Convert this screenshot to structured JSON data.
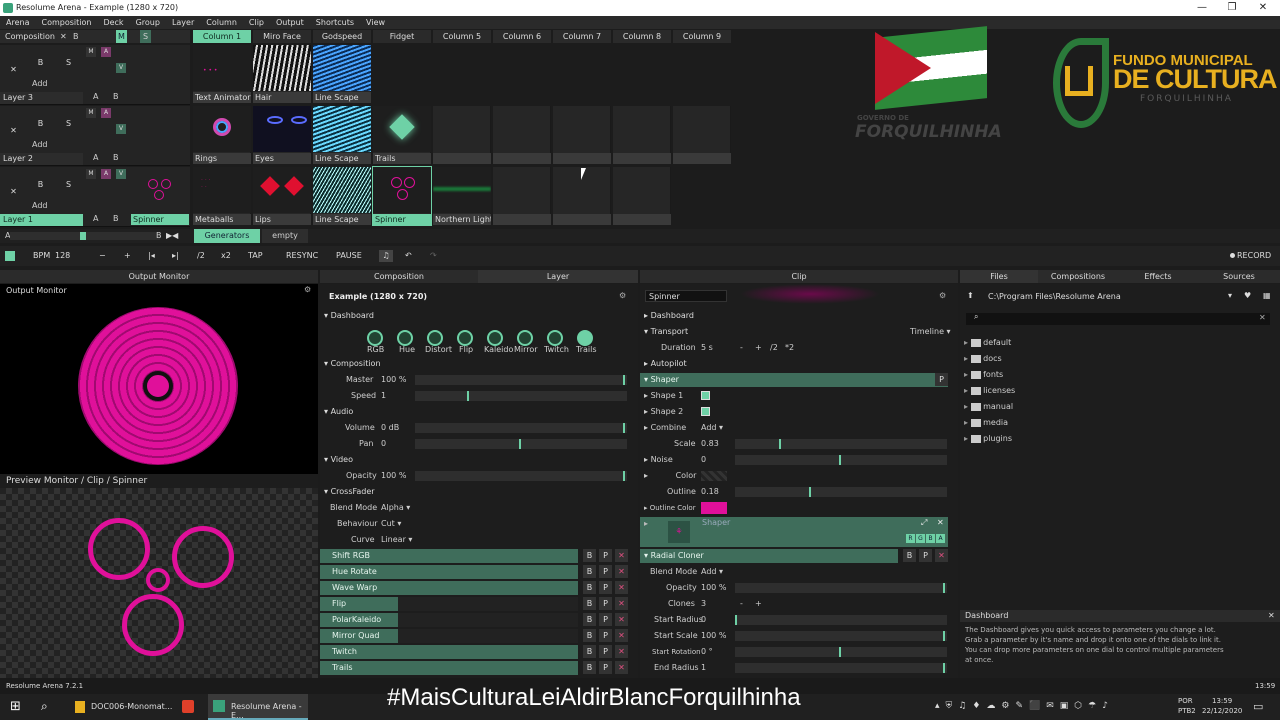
{
  "window": {
    "title": "Resolume Arena - Example (1280 x 720)",
    "minimize": "—",
    "maximize": "❐",
    "close": "✕"
  },
  "menu": [
    "Arena",
    "Composition",
    "Deck",
    "Group",
    "Layer",
    "Column",
    "Clip",
    "Output",
    "Shortcuts",
    "View"
  ],
  "composition": {
    "label": "Composition",
    "x": "✕",
    "b": "B",
    "m": "M",
    "s": "S"
  },
  "columns": [
    "Column 1",
    "Miro Face",
    "Godspeed",
    "Fidget",
    "Column 5",
    "Column 6",
    "Column 7",
    "Column 8",
    "Column 9"
  ],
  "layers": [
    {
      "name": "Layer 3",
      "clips": [
        "Text Animator",
        "Hair",
        "Line Scape",
        "",
        "",
        "",
        "",
        "",
        ""
      ]
    },
    {
      "name": "Layer 2",
      "clips": [
        "Rings",
        "Eyes",
        "Line Scape",
        "Trails",
        "",
        "",
        "",
        "",
        ""
      ]
    },
    {
      "name": "Layer 1",
      "clips": [
        "Spinner",
        "Metaballs",
        "Lips",
        "Line Scape",
        "Spinner",
        "Northern Light",
        "",
        "",
        ""
      ]
    }
  ],
  "layer_buttons": {
    "close": "✕",
    "b": "B",
    "s": "S",
    "add": "Add",
    "m": "M",
    "a": "A",
    "v": "V",
    "ab_a": "A",
    "ab_b": "B"
  },
  "deck": {
    "a": "A",
    "b": "B",
    "tabs": [
      "Generators",
      "empty"
    ]
  },
  "transport": {
    "bpm_label": "BPM",
    "bpm": "128",
    "minus": "−",
    "plus": "+",
    "prev": "|◂",
    "next": "▸|",
    "half": "/2",
    "double": "x2",
    "tap": "TAP",
    "resync": "RESYNC",
    "pause": "PAUSE",
    "record": "RECORD"
  },
  "panels": {
    "output_monitor": "Output Monitor",
    "composition": "Composition",
    "layer": "Layer",
    "clip": "Clip",
    "files": "Files",
    "compositions": "Compositions",
    "effects": "Effects",
    "sources": "Sources"
  },
  "monitor": {
    "title": "Output Monitor",
    "preview": "Preview Monitor / Clip / Spinner"
  },
  "comp_panel": {
    "title": "Example (1280 x 720)",
    "dashboard": "Dashboard",
    "dials": [
      "RGB",
      "Hue",
      "Distort",
      "Flip",
      "Kaleido",
      "Mirror",
      "Twitch",
      "Trails"
    ],
    "composition": "Composition",
    "master_label": "Master",
    "master": "100 %",
    "speed_label": "Speed",
    "speed": "1",
    "audio": "Audio",
    "volume_label": "Volume",
    "volume": "0 dB",
    "pan_label": "Pan",
    "pan": "0",
    "video": "Video",
    "opacity_label": "Opacity",
    "opacity": "100 %",
    "crossfader": "CrossFader",
    "blend_label": "Blend Mode",
    "blend": "Alpha",
    "behaviour_label": "Behaviour",
    "behaviour": "Cut",
    "curve_label": "Curve",
    "curve": "Linear",
    "effects": [
      "Shift RGB",
      "Hue Rotate",
      "Wave Warp",
      "Flip",
      "PolarKaleido",
      "Mirror Quad",
      "Twitch",
      "Trails"
    ],
    "fx_b": "B",
    "fx_p": "P",
    "fx_x": "✕"
  },
  "clip_panel": {
    "name": "Spinner",
    "dashboard": "Dashboard",
    "transport": "Transport",
    "timeline": "Timeline",
    "duration_label": "Duration",
    "duration": "5 s",
    "dminus": "-",
    "dplus": "+",
    "dhalf": "/2",
    "ddouble": "*2",
    "autopilot": "Autopilot",
    "shaper": "Shaper",
    "shaper_p": "P",
    "shape1": "Shape 1",
    "shape2": "Shape 2",
    "combine_label": "Combine",
    "combine": "Add",
    "scale_label": "Scale",
    "scale": "0.83",
    "noise_label": "Noise",
    "noise": "0",
    "color_label": "Color",
    "outline_label": "Outline",
    "outline": "0.18",
    "outline_color_label": "Outline Color",
    "shaper_thumb": "Shaper",
    "rgba": [
      "R",
      "G",
      "B",
      "A"
    ],
    "radial": "Radial Cloner",
    "blend_label": "Blend Mode",
    "blend": "Add",
    "opacity_label": "Opacity",
    "opacity": "100 %",
    "clones_label": "Clones",
    "clones": "3",
    "cminus": "-",
    "cplus": "+",
    "start_radius_label": "Start Radius",
    "start_radius": "0",
    "start_scale_label": "Start Scale",
    "start_scale": "100 %",
    "start_rotation_label": "Start Rotation",
    "start_rotation": "0 °",
    "end_radius_label": "End Radius",
    "end_radius": "1"
  },
  "files_panel": {
    "path": "C:\\Program Files\\Resolume Arena",
    "folders": [
      "default",
      "docs",
      "fonts",
      "licenses",
      "manual",
      "media",
      "plugins"
    ],
    "dash_title": "Dashboard",
    "dash_text": "The Dashboard gives you quick access to parameters you change a lot. Grab a parameter by it's name and drop it onto one of the dials to link it. You can drop more parameters on one dial to control multiple parameters at once.",
    "dash_close": "✕"
  },
  "overlay": {
    "fundo1": "FUNDO MUNICIPAL",
    "fundo2": "DE CULTURA",
    "fundo3": "FORQUILHINHA",
    "gov1": "GOVERNO DE",
    "gov2": "FORQUILHINHA",
    "hashtag": "#MaisCulturaLeiAldirBlancForquilhinha"
  },
  "status": {
    "version": "Resolume Arena 7.2.1",
    "time": "13:59"
  },
  "taskbar": {
    "app1": "DOC006-Monomat...",
    "app2": "Resolume Arena - E...",
    "lang1": "POR",
    "lang2": "PTB2",
    "clock": "13:59",
    "date": "22/12/2020"
  },
  "colors": {
    "accent": "#6ed1a6",
    "magenta": "#e0109a",
    "green_bar": "#3f6d5b"
  }
}
